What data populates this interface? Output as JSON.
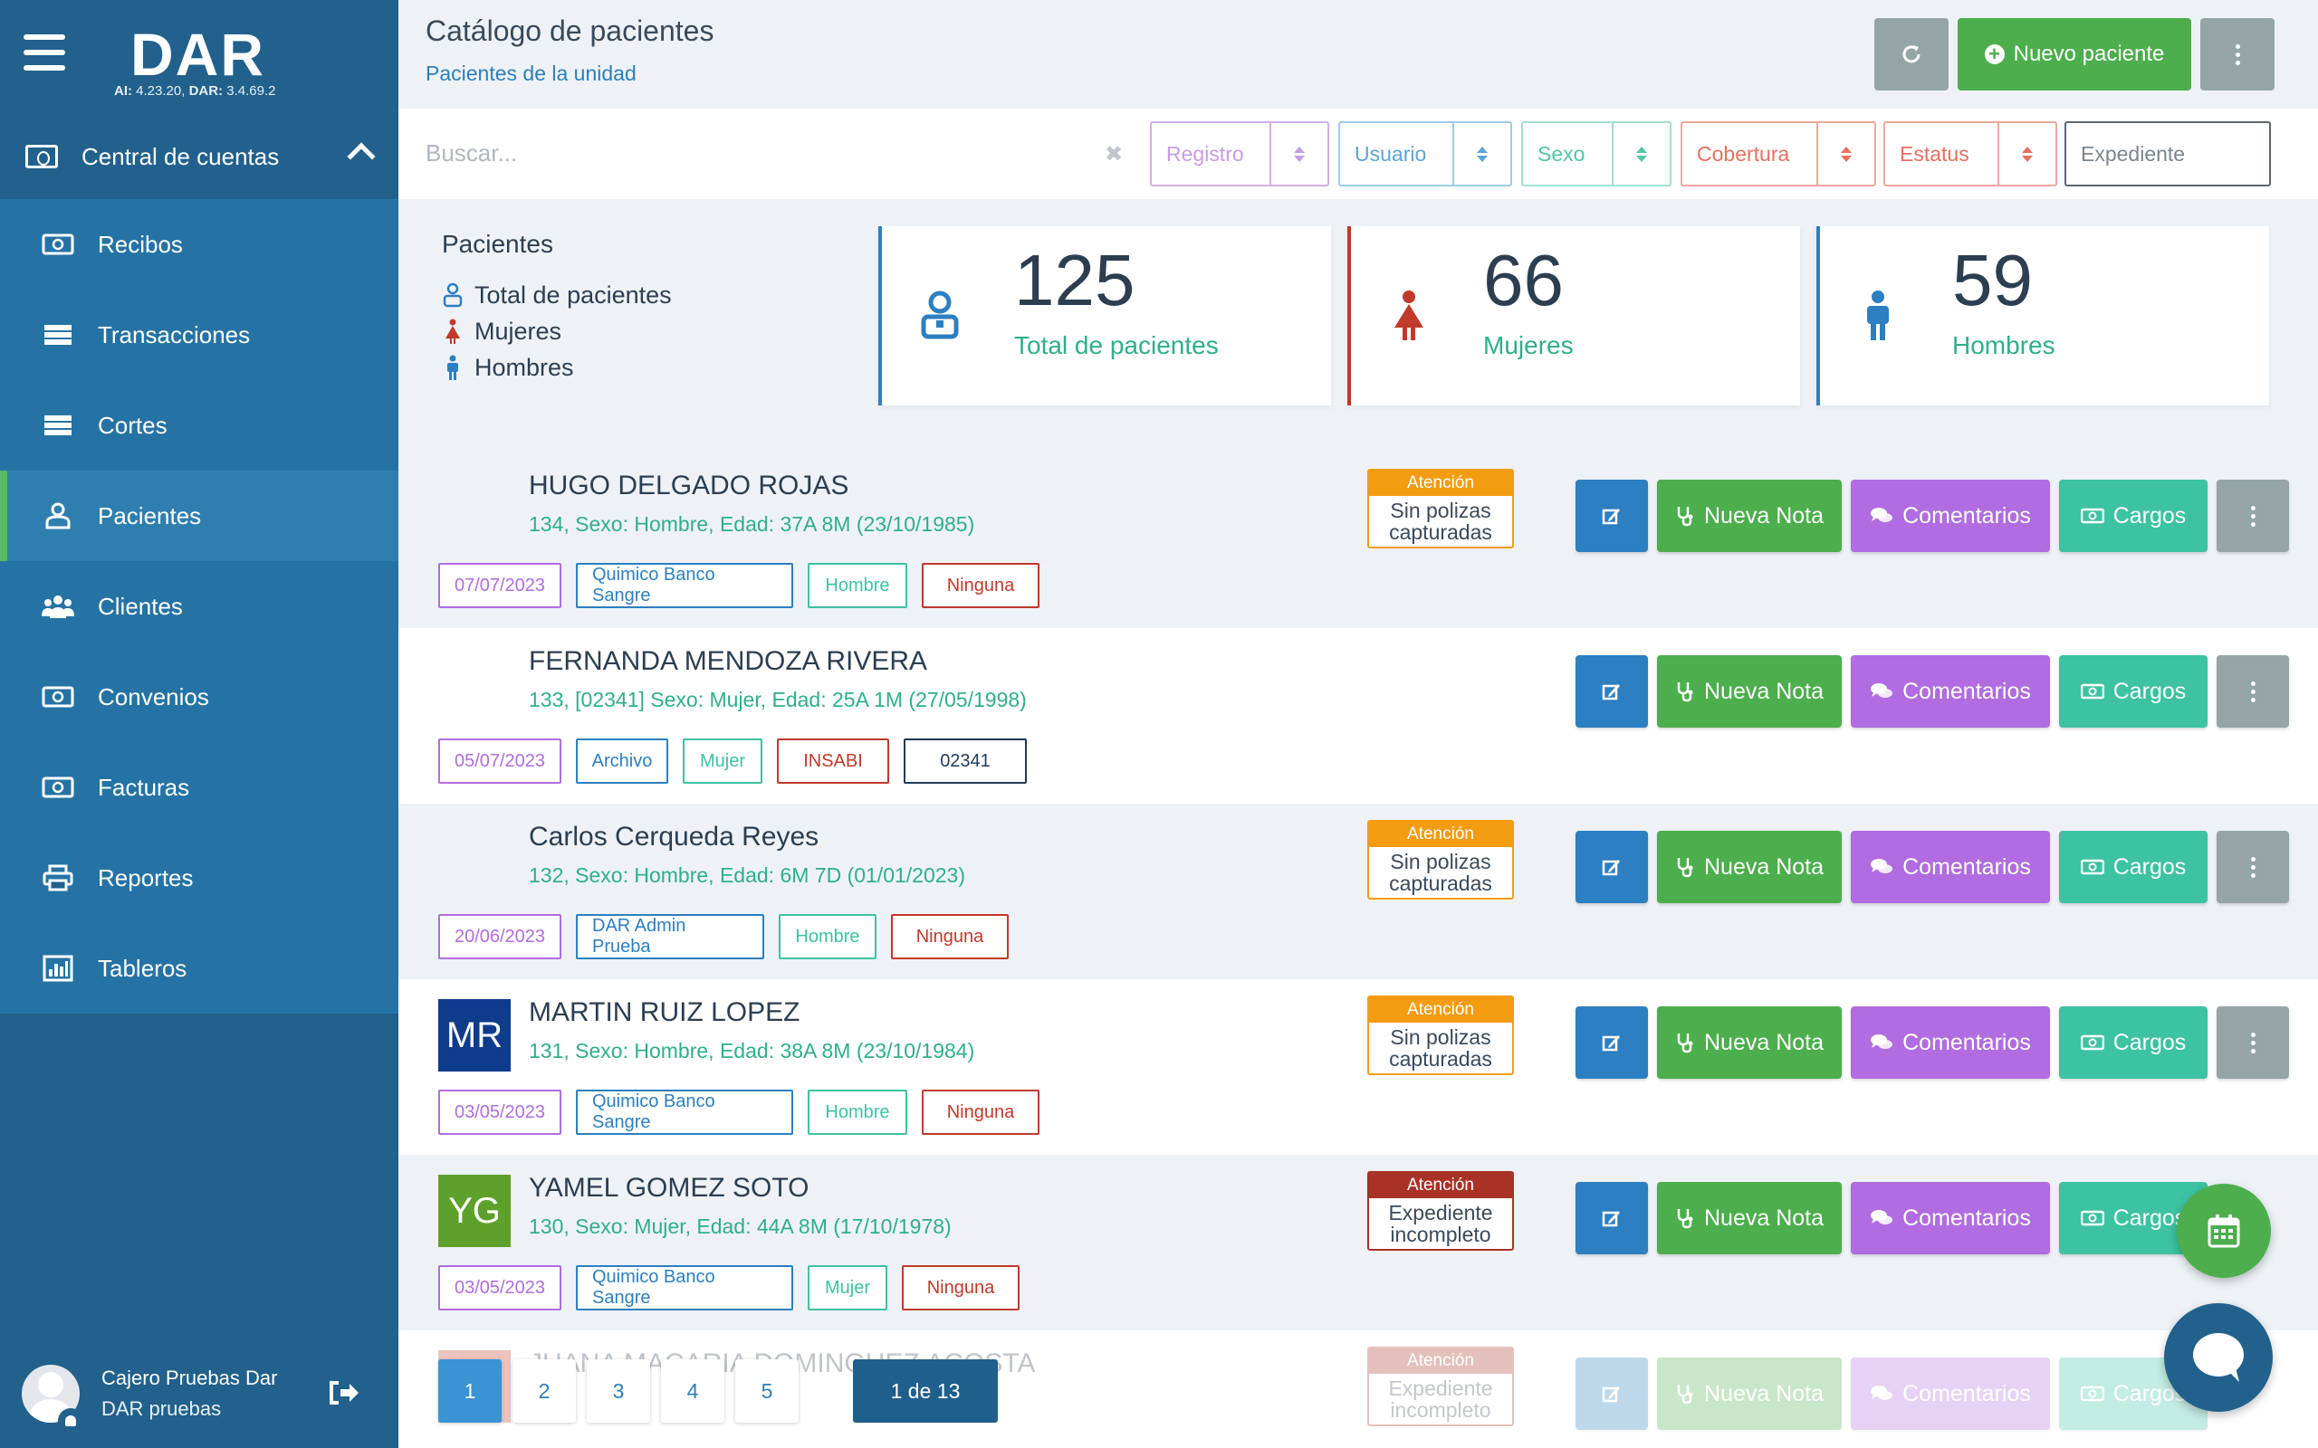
{
  "app": {
    "logo": "DAR",
    "version_ai_label": "AI:",
    "version_ai": "4.23.20,",
    "version_dar_label": "DAR:",
    "version_dar": "3.4.69.2"
  },
  "sidebar": {
    "section": "Central de cuentas",
    "items": [
      {
        "label": "Recibos",
        "icon": "money-icon"
      },
      {
        "label": "Transacciones",
        "icon": "list-icon"
      },
      {
        "label": "Cortes",
        "icon": "list-icon"
      },
      {
        "label": "Pacientes",
        "icon": "patient-icon",
        "active": true
      },
      {
        "label": "Clientes",
        "icon": "users-icon"
      },
      {
        "label": "Convenios",
        "icon": "money-icon"
      },
      {
        "label": "Facturas",
        "icon": "money-icon"
      },
      {
        "label": "Reportes",
        "icon": "print-icon"
      },
      {
        "label": "Tableros",
        "icon": "chart-icon"
      }
    ],
    "user": {
      "name": "Cajero Pruebas Dar",
      "role": "DAR pruebas"
    }
  },
  "header": {
    "title": "Catálogo de pacientes",
    "subtitle": "Pacientes de la unidad",
    "new_button": "Nuevo paciente"
  },
  "filters": {
    "search_placeholder": "Buscar...",
    "registro": "Registro",
    "usuario": "Usuario",
    "sexo": "Sexo",
    "cobertura": "Cobertura",
    "estatus": "Estatus",
    "expediente": "Expediente"
  },
  "stats": {
    "heading": "Pacientes",
    "legend": [
      "Total de pacientes",
      "Mujeres",
      "Hombres"
    ],
    "cards": [
      {
        "value": "125",
        "label": "Total de pacientes",
        "color": "#2c7fc0"
      },
      {
        "value": "66",
        "label": "Mujeres",
        "color": "#c0392b"
      },
      {
        "value": "59",
        "label": "Hombres",
        "color": "#2c7fc0"
      }
    ]
  },
  "actions": {
    "nota": "Nueva Nota",
    "comentarios": "Comentarios",
    "cargos": "Cargos"
  },
  "patients": [
    {
      "name": "HUGO DELGADO ROJAS",
      "details": "134, Sexo: Hombre, Edad: 37A 8M (23/10/1985)",
      "tags": [
        "07/07/2023",
        "Quimico Banco Sangre",
        "Hombre",
        "Ninguna"
      ],
      "attention": {
        "title": "Atención",
        "line1": "Sin polizas",
        "line2": "capturadas"
      }
    },
    {
      "name": "FERNANDA MENDOZA RIVERA",
      "details": "133, [02341] Sexo: Mujer, Edad: 25A 1M (27/05/1998)",
      "tags": [
        "05/07/2023",
        "Archivo",
        "Mujer",
        "INSABI",
        "02341"
      ]
    },
    {
      "name": "Carlos Cerqueda Reyes",
      "details": "132, Sexo: Hombre, Edad: 6M 7D (01/01/2023)",
      "tags": [
        "20/06/2023",
        "DAR Admin Prueba",
        "Hombre",
        "Ninguna"
      ],
      "attention": {
        "title": "Atención",
        "line1": "Sin polizas",
        "line2": "capturadas"
      }
    },
    {
      "name": "MARTIN RUIZ LOPEZ",
      "initials": "MR",
      "details": "131, Sexo: Hombre, Edad: 38A 8M (23/10/1984)",
      "tags": [
        "03/05/2023",
        "Quimico Banco Sangre",
        "Hombre",
        "Ninguna"
      ],
      "attention": {
        "title": "Atención",
        "line1": "Sin polizas",
        "line2": "capturadas"
      }
    },
    {
      "name": "YAMEL GOMEZ SOTO",
      "initials": "YG",
      "details": "130, Sexo: Mujer, Edad: 44A 8M (17/10/1978)",
      "tags": [
        "03/05/2023",
        "Quimico Banco Sangre",
        "Mujer",
        "Ninguna"
      ],
      "attention": {
        "title": "Atención",
        "line1": "Expediente",
        "line2": "incompleto"
      }
    },
    {
      "name": "JUANA MACARIA DOMINGUEZ ACOSTA",
      "attention": {
        "title": "Atención",
        "line1": "Expediente",
        "line2": "incompleto"
      }
    }
  ],
  "pagination": {
    "pages": [
      "1",
      "2",
      "3",
      "4",
      "5"
    ],
    "count": "1 de 13"
  },
  "colors": {
    "sidebar": "#21618c",
    "primary": "#2c7fc0",
    "success": "#4cae4c",
    "purple": "#b06ce0",
    "teal": "#3dc2a2",
    "orange": "#f39c12",
    "danger": "#c0392b"
  }
}
